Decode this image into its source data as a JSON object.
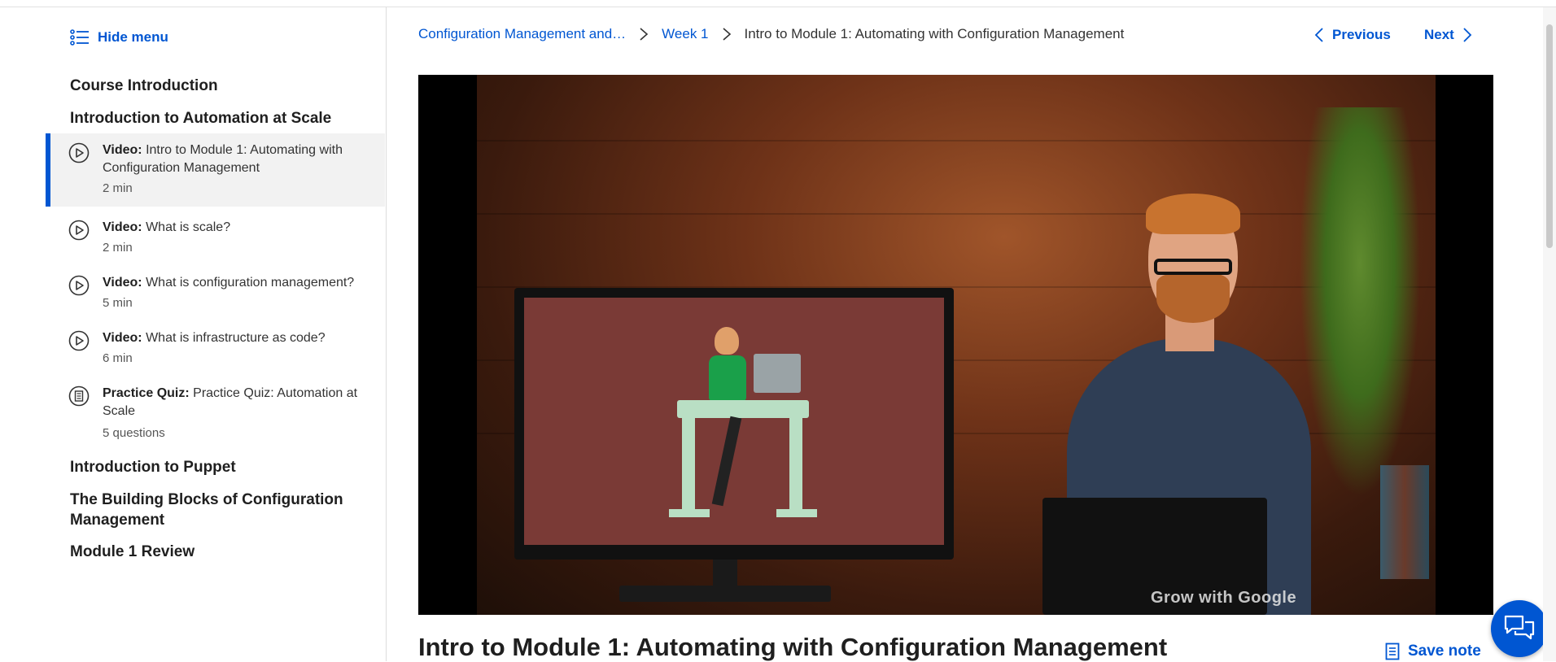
{
  "sidebar": {
    "hide_menu_label": "Hide menu",
    "sections": [
      {
        "title": "Course Introduction"
      },
      {
        "title": "Introduction to Automation at Scale"
      },
      {
        "title": "Introduction to Puppet"
      },
      {
        "title": "The Building Blocks of Configuration Management"
      },
      {
        "title": "Module 1 Review"
      }
    ],
    "items": [
      {
        "type": "Video:",
        "name": "Intro to Module 1: Automating with Configuration Management",
        "meta": "2 min",
        "icon": "play-icon",
        "active": true
      },
      {
        "type": "Video:",
        "name": "What is scale?",
        "meta": "2 min",
        "icon": "play-icon"
      },
      {
        "type": "Video:",
        "name": "What is configuration management?",
        "meta": "5 min",
        "icon": "play-icon"
      },
      {
        "type": "Video:",
        "name": "What is infrastructure as code?",
        "meta": "6 min",
        "icon": "play-icon"
      },
      {
        "type": "Practice Quiz:",
        "name": "Practice Quiz: Automation at Scale",
        "meta": "5 questions",
        "icon": "quiz-icon"
      }
    ]
  },
  "breadcrumb": {
    "course": "Configuration Management and…",
    "week": "Week 1",
    "current": "Intro to Module 1: Automating with Configuration Management"
  },
  "nav": {
    "previous_label": "Previous",
    "next_label": "Next"
  },
  "video": {
    "watermark": "Grow with Google"
  },
  "main": {
    "title": "Intro to Module 1: Automating with Configuration Management",
    "save_note_label": "Save note"
  },
  "colors": {
    "accent": "#0056d2",
    "active_bg": "#f2f2f2"
  }
}
